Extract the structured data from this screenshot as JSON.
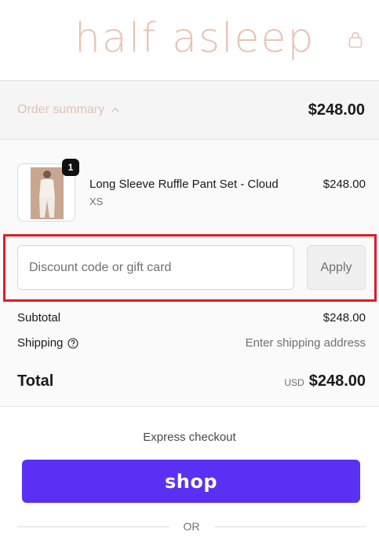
{
  "header": {
    "logo_text": "half asleep",
    "bag_icon": "shopping-bag-icon"
  },
  "summary": {
    "label": "Order summary",
    "toggle_icon": "chevron-up-icon",
    "total": "$248.00"
  },
  "cart": {
    "items": [
      {
        "name": "Long Sleeve Ruffle Pant Set - Cloud",
        "variant": "XS",
        "price": "$248.00",
        "quantity": "1"
      }
    ]
  },
  "discount": {
    "placeholder": "Discount code or gift card",
    "value": "",
    "apply_label": "Apply"
  },
  "totals": {
    "subtotal_label": "Subtotal",
    "subtotal_value": "$248.00",
    "shipping_label": "Shipping",
    "shipping_info_icon": "question-circle-icon",
    "shipping_value": "Enter shipping address",
    "total_label": "Total",
    "currency": "USD",
    "total_value": "$248.00"
  },
  "express": {
    "label": "Express checkout",
    "shop_button_text": "shop",
    "or_text": "OR"
  },
  "colors": {
    "brand": "#e9c4b4",
    "shop_pay": "#5a31f4",
    "highlight": "#e01c24"
  }
}
